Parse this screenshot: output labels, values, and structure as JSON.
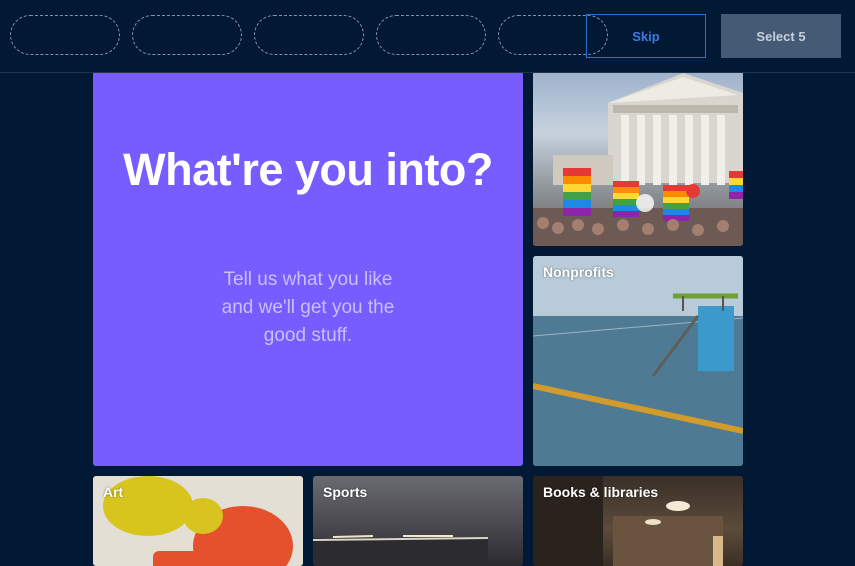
{
  "topbar": {
    "slots_count": 5,
    "skip_label": "Skip",
    "select_label": "Select 5"
  },
  "hero": {
    "title": "What're you into?",
    "subtitle": "Tell us what you like and we'll get you the good stuff."
  },
  "tiles": [
    {
      "label": ""
    },
    {
      "label": "Nonprofits"
    },
    {
      "label": "Art"
    },
    {
      "label": "Sports"
    },
    {
      "label": "Books & libraries"
    }
  ],
  "colors": {
    "background": "#021935",
    "hero": "#775cff",
    "skip_border": "#2d6fd1",
    "select_bg": "#455a75"
  }
}
